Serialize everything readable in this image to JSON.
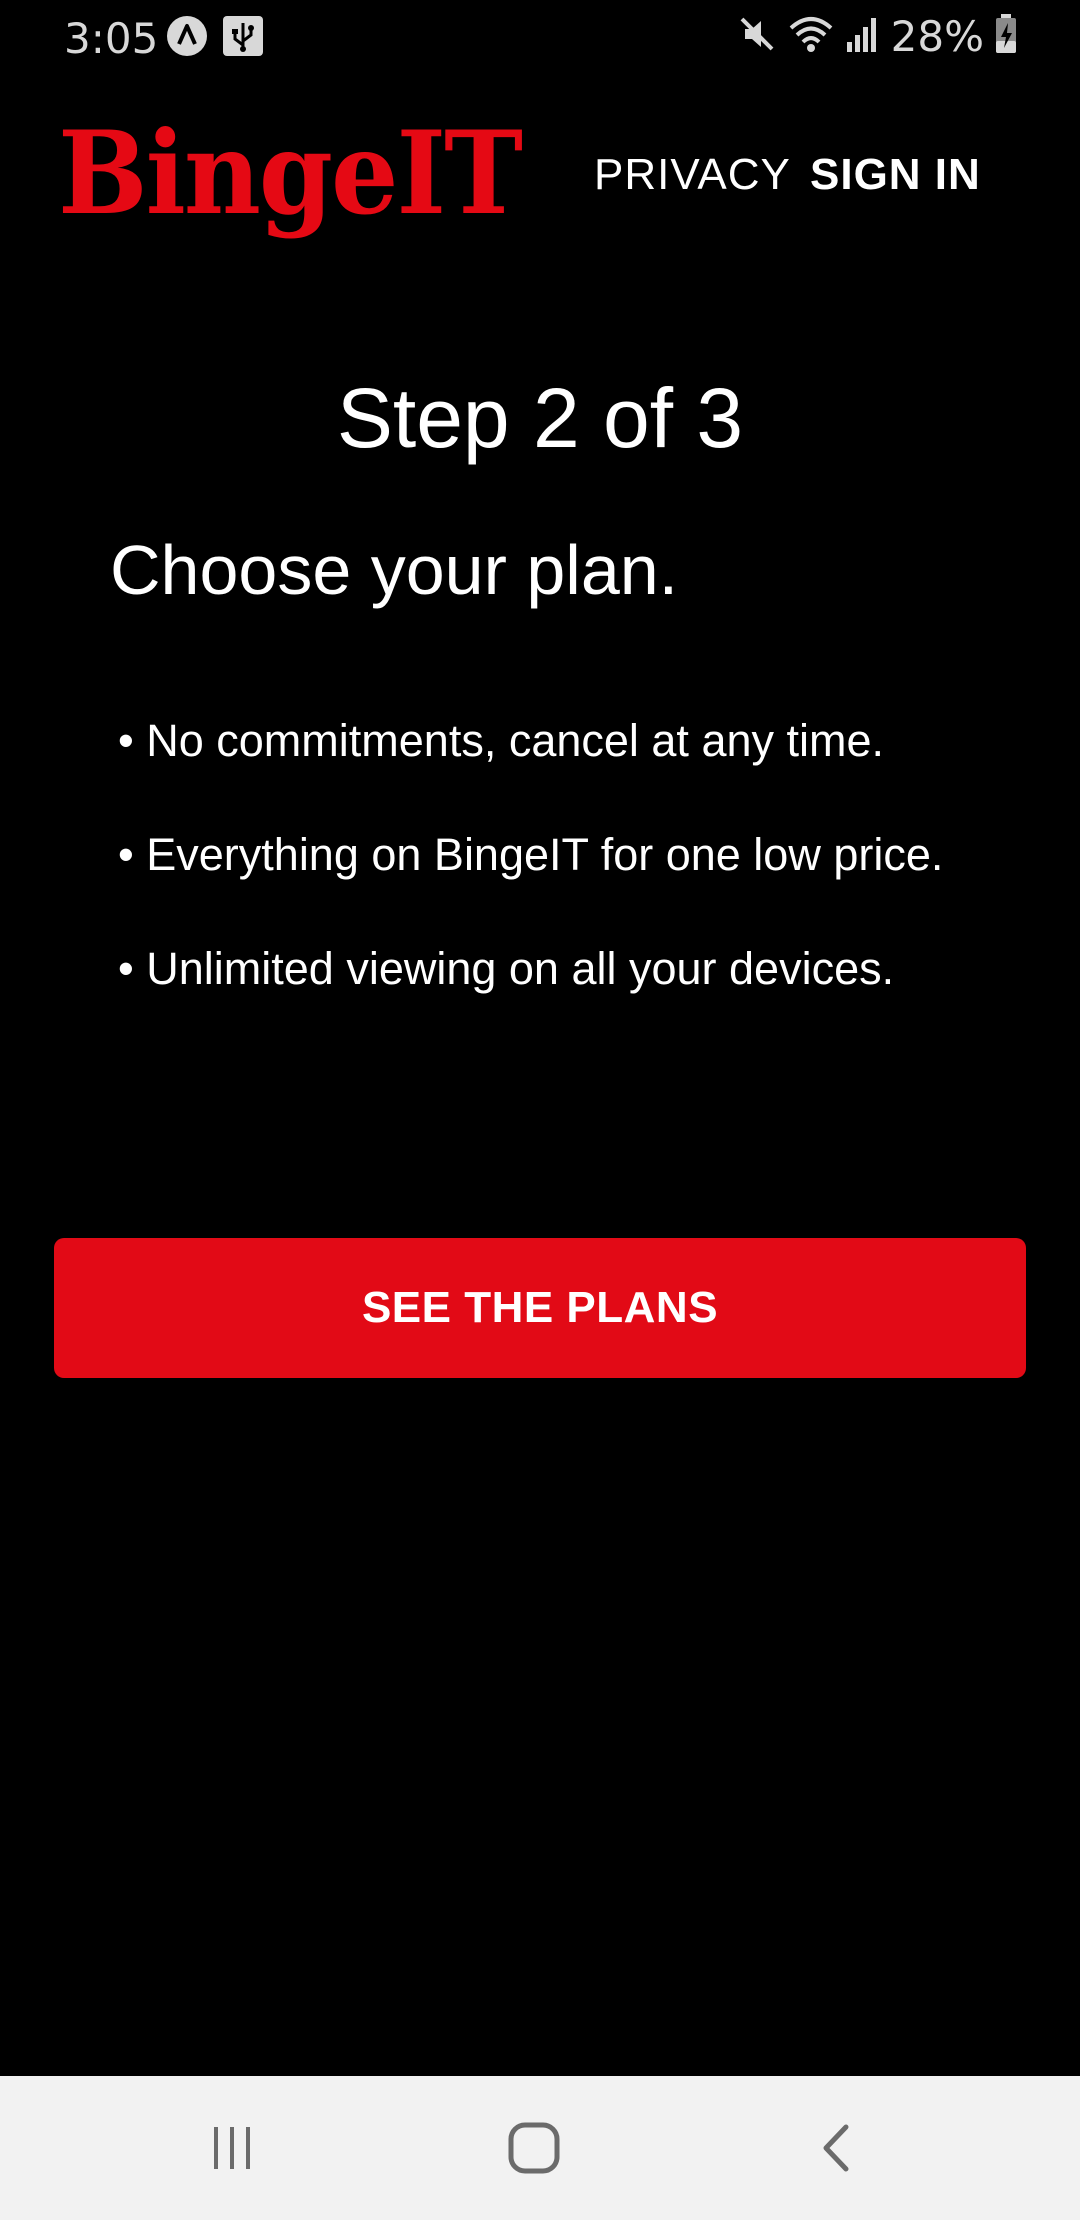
{
  "status_bar": {
    "time": "3:05",
    "battery": "28%",
    "icons": [
      "navigation-icon",
      "usb-icon",
      "mute-icon",
      "wifi-icon",
      "signal-icon",
      "battery-charging-icon"
    ]
  },
  "header": {
    "logo": "BingeIT",
    "privacy_label": "PRIVACY",
    "signin_label": "SIGN IN"
  },
  "main": {
    "step": "Step 2 of 3",
    "heading": "Choose your plan.",
    "bullets": [
      "• No commitments, cancel at any time.",
      "• Everything on BingeIT for one low price.",
      "• Unlimited viewing on all your devices."
    ],
    "cta_label": "SEE THE PLANS"
  },
  "colors": {
    "brand": "#e50914",
    "background": "#000000",
    "text": "#ffffff",
    "nav_bar": "#f2f2f2"
  },
  "nav_bar": {
    "buttons": [
      "recent-apps-icon",
      "home-icon",
      "back-icon"
    ]
  }
}
